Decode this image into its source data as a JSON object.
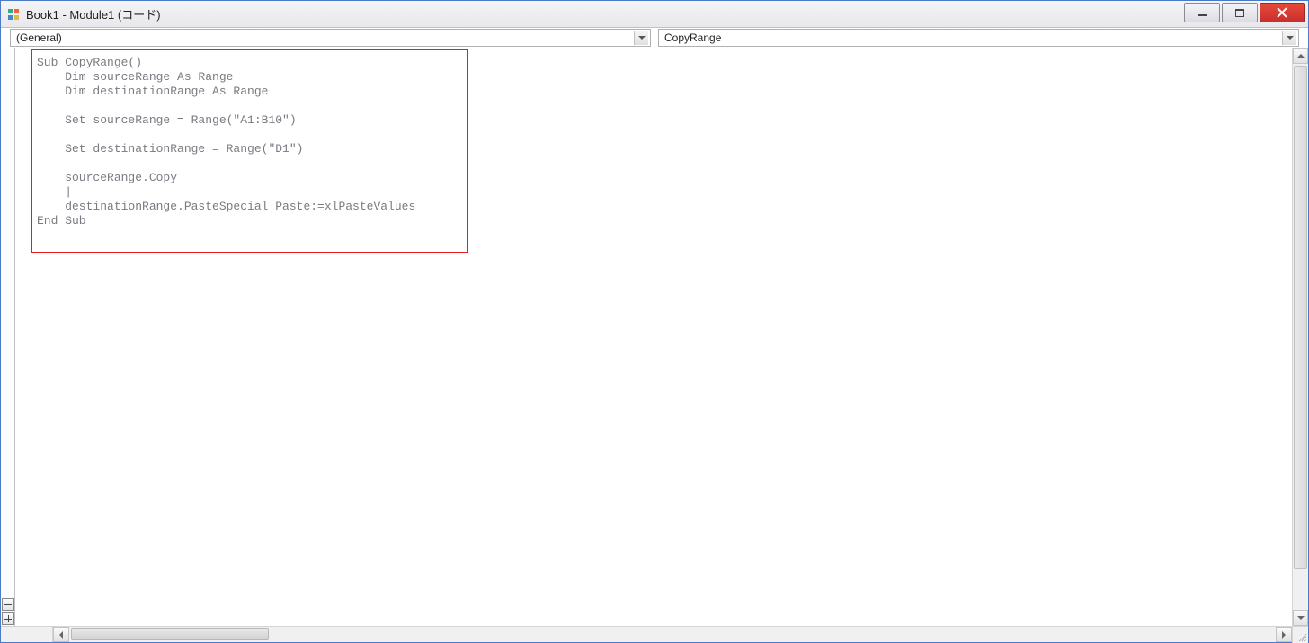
{
  "titlebar": {
    "title": "Book1 - Module1 (コード)"
  },
  "combos": {
    "left": "(General)",
    "right": "CopyRange"
  },
  "code": {
    "lines": [
      "Sub CopyRange()",
      "    Dim sourceRange As Range",
      "    Dim destinationRange As Range",
      "",
      "    Set sourceRange = Range(\"A1:B10\")",
      "",
      "    Set destinationRange = Range(\"D1\")",
      "",
      "    sourceRange.Copy",
      "    |",
      "    destinationRange.PasteSpecial Paste:=xlPasteValues",
      "End Sub"
    ]
  }
}
